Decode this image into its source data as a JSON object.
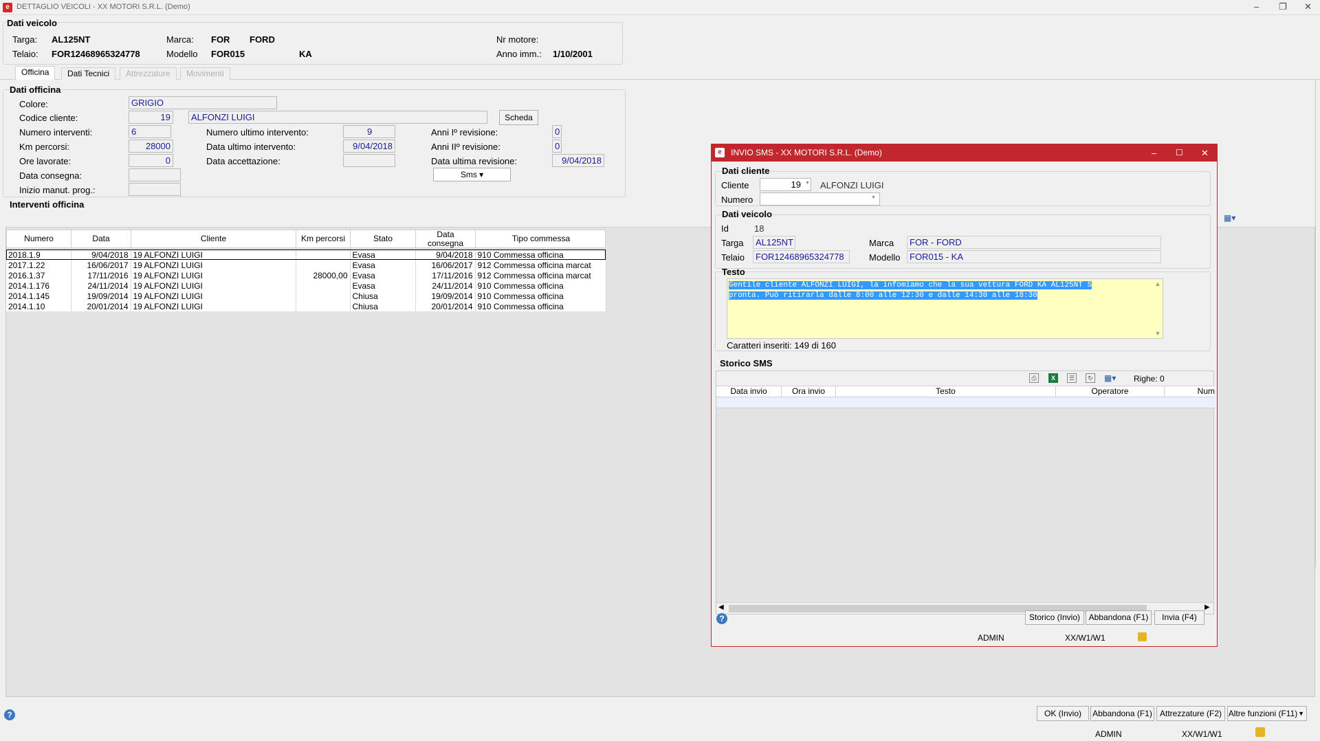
{
  "main_window": {
    "title": "DETTAGLIO VEICOLI - XX  MOTORI S.R.L.  (Demo)",
    "controls": {
      "minimize": "–",
      "restore": "❐",
      "close": "✕"
    }
  },
  "vehicle": {
    "section_title": "Dati veicolo",
    "targa_label": "Targa:",
    "targa": "AL125NT",
    "telaio_label": "Telaio:",
    "telaio": "FOR12468965324778",
    "marca_label": "Marca:",
    "marca_code": "FOR",
    "marca_name": "FORD",
    "modello_label": "Modello",
    "modello_code": "FOR015",
    "modello_name": "KA",
    "motore_label": "Nr motore:",
    "motore": "",
    "anno_label": "Anno imm.:",
    "anno": "1/10/2001"
  },
  "tabs": [
    {
      "label": "Officina",
      "active": true
    },
    {
      "label": "Dati Tecnici",
      "active": false
    },
    {
      "label": "Attrezzature",
      "disabled": true
    },
    {
      "label": "Movimenti",
      "disabled": true
    }
  ],
  "officina": {
    "section_title": "Dati officina",
    "colore_label": "Colore:",
    "colore": "GRIGIO",
    "codice_label": "Codice cliente:",
    "codice": "19",
    "cliente_nome": "ALFONZI LUIGI",
    "scheda_button": "Scheda",
    "num_interventi_label": "Numero interventi:",
    "num_interventi": "6",
    "km_label": "Km percorsi:",
    "km": "28000",
    "ore_label": "Ore lavorate:",
    "ore": "0",
    "consegna_label": "Data consegna:",
    "inizio_label": "Inizio manut. prog.:",
    "num_ultimo_label": "Numero ultimo intervento:",
    "num_ultimo": "9",
    "data_ultimo_label": "Data ultimo intervento:",
    "data_ultimo": "9/04/2018",
    "accettazione_label": "Data accettazione:",
    "anni1_label": "Anni Iº revisione:",
    "anni1": "0",
    "anni2_label": "Anni IIº revisione:",
    "anni2": "0",
    "ultima_rev_label": "Data ultima revisione:",
    "ultima_rev": "9/04/2018",
    "sms_button": "Sms ▾"
  },
  "interventi": {
    "section_title": "Interventi officina",
    "columns": [
      "Numero",
      "Data",
      "Cliente",
      "Km percorsi",
      "Stato",
      "Data consegna",
      "Tipo commessa"
    ],
    "rows": [
      [
        "2018.1.9",
        "9/04/2018",
        "19 ALFONZI LUIGI",
        "",
        "Evasa",
        "9/04/2018",
        "910 Commessa officina"
      ],
      [
        "2017.1.22",
        "16/06/2017",
        "19 ALFONZI LUIGI",
        "",
        "Evasa",
        "16/06/2017",
        "912 Commessa officina marcat"
      ],
      [
        "2016.1.37",
        "17/11/2016",
        "19 ALFONZI LUIGI",
        "28000,00",
        "Evasa",
        "17/11/2016",
        "912 Commessa officina marcat"
      ],
      [
        "2014.1.176",
        "24/11/2014",
        "19 ALFONZI LUIGI",
        "",
        "Evasa",
        "24/11/2014",
        "910 Commessa officina"
      ],
      [
        "2014.1.145",
        "19/09/2014",
        "19 ALFONZI LUIGI",
        "",
        "Chiusa",
        "19/09/2014",
        "910 Commessa officina"
      ],
      [
        "2014.1.10",
        "20/01/2014",
        "19 ALFONZI LUIGI",
        "",
        "Chiusa",
        "20/01/2014",
        "910 Commessa officina"
      ]
    ]
  },
  "footer": {
    "ok": "OK (Invio)",
    "abbandona": "Abbandona (F1)",
    "attrezzature": "Attrezzature (F2)",
    "altre": "Altre funzioni (F11)",
    "user": "ADMIN",
    "path": "XX/W1/W1"
  },
  "sms_dialog": {
    "title": "INVIO SMS - XX  MOTORI S.R.L.  (Demo)",
    "cliente_section": "Dati cliente",
    "cliente_label": "Cliente",
    "cliente_code": "19",
    "cliente_nome": "ALFONZI LUIGI",
    "numero_label": "Numero",
    "numero": "",
    "veicolo_section": "Dati veicolo",
    "id_label": "Id",
    "id": "18",
    "targa_label": "Targa",
    "targa": "AL125NT",
    "telaio_label": "Telaio",
    "telaio": "FOR12468965324778",
    "marca_label": "Marca",
    "marca": "FOR - FORD",
    "modello_label": "Modello",
    "modello": "FOR015 - KA",
    "testo_section": "Testo",
    "testo_line1": "Gentile cliente ALFONZI LUIGI, la infomiamo che la sua vettura FORD KA AL125NT S",
    "testo_line2": "pronta. Può ritirarla dalle 8:00 alle 12:30 e dalle 14:30 alle 18:30",
    "caratteri": "Caratteri inseriti: 149 di 160",
    "storico_section": "Storico SMS",
    "righe": "Righe: 0",
    "storico_columns": [
      "Data invio",
      "Ora invio",
      "Testo",
      "Operatore",
      "Num"
    ],
    "storico_button": "Storico (Invio)",
    "abbandona_button": "Abbandona (F1)",
    "invia_button": "Invia (F4)",
    "user": "ADMIN",
    "path": "XX/W1/W1"
  },
  "colors": {
    "accent": "#c1272d",
    "value_text": "#1a1a9a",
    "highlight": "#3399ff",
    "textarea_bg": "#ffffc0"
  }
}
